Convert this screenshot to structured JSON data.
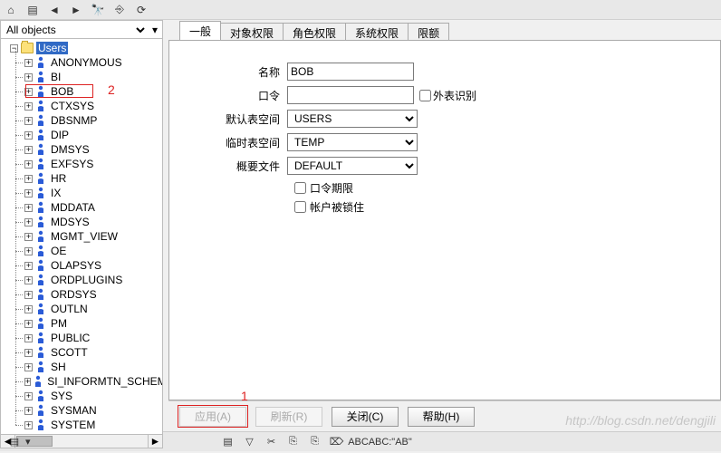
{
  "toolbar_icons": [
    "home",
    "book",
    "back",
    "forward",
    "binoculars",
    "link",
    "refresh"
  ],
  "filter_label": "All objects",
  "tree": {
    "root": "Users",
    "selected": "Users",
    "highlight_child": "BOB",
    "children": [
      "ANONYMOUS",
      "BI",
      "BOB",
      "CTXSYS",
      "DBSNMP",
      "DIP",
      "DMSYS",
      "EXFSYS",
      "HR",
      "IX",
      "MDDATA",
      "MDSYS",
      "MGMT_VIEW",
      "OE",
      "OLAPSYS",
      "ORDPLUGINS",
      "ORDSYS",
      "OUTLN",
      "PM",
      "PUBLIC",
      "SCOTT",
      "SH",
      "SI_INFORMTN_SCHEM",
      "SYS",
      "SYSMAN",
      "SYSTEM"
    ]
  },
  "annotations": {
    "tree": "2",
    "apply": "1"
  },
  "tabs": [
    "一般",
    "对象权限",
    "角色权限",
    "系统权限",
    "限额"
  ],
  "active_tab": 0,
  "form": {
    "name_label": "名称",
    "name_value": "BOB",
    "password_label": "口令",
    "password_value": "",
    "external_label": "外表识别",
    "default_ts_label": "默认表空间",
    "default_ts_value": "USERS",
    "temp_ts_label": "临时表空间",
    "temp_ts_value": "TEMP",
    "profile_label": "概要文件",
    "profile_value": "DEFAULT",
    "pw_expire_label": "口令期限",
    "locked_label": "帐户被锁住"
  },
  "buttons": {
    "apply": "应用(A)",
    "refresh": "刷新(R)",
    "close": "关闭(C)",
    "help": "帮助(H)"
  },
  "bottom_toolbar": [
    "▤",
    "▽",
    "✂",
    "⎘",
    "⎘",
    "⌦",
    "ABC",
    "ABC:",
    "\"AB\""
  ],
  "watermark": "http://blog.csdn.net/dengjili"
}
